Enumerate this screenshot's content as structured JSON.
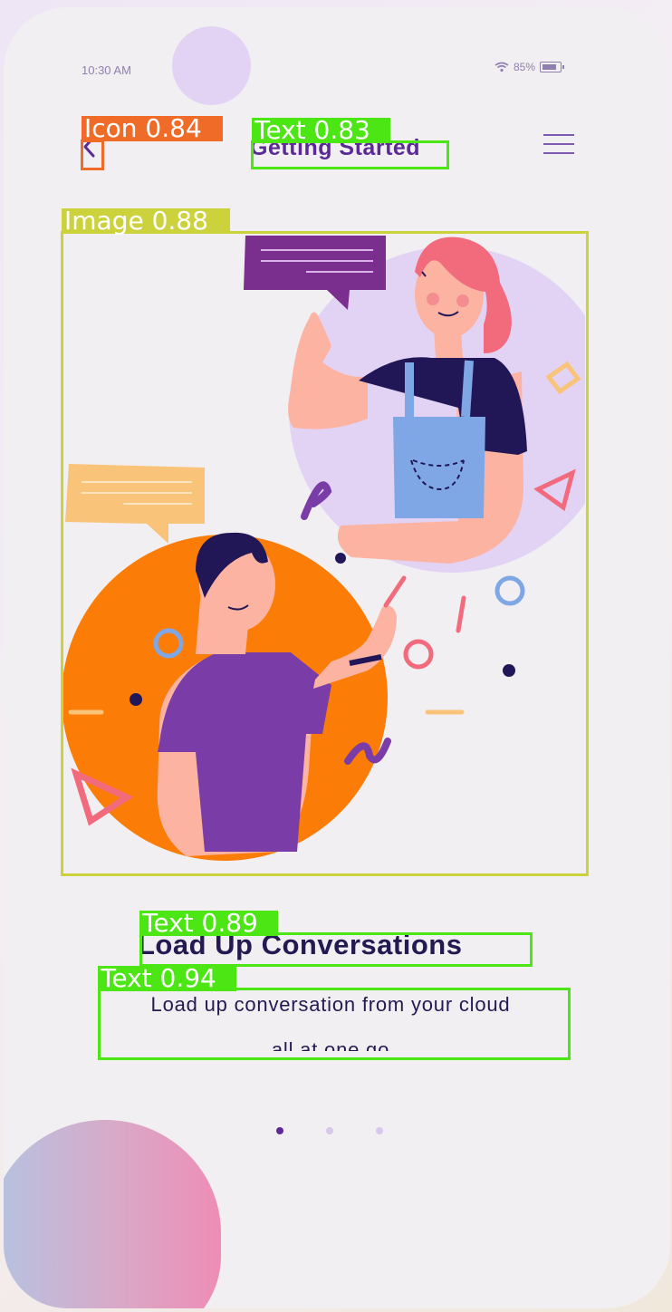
{
  "status_bar": {
    "time": "10:30 AM",
    "battery": "85%"
  },
  "header": {
    "title": "Getting Started"
  },
  "onboarding": {
    "headline": "Load Up Conversations",
    "subtitle_line1": "Load up conversation from your cloud",
    "subtitle_line2": "all at one go",
    "total_pages": 3,
    "active_page": 1
  },
  "detections": [
    {
      "label": "Icon 0.84",
      "color": "#f06b27"
    },
    {
      "label": "Text 0.83",
      "color": "#4ce614"
    },
    {
      "label": "Image 0.88",
      "color": "#ccd23b"
    },
    {
      "label": "Text 0.89",
      "color": "#4ce614"
    },
    {
      "label": "Text 0.94",
      "color": "#4ce614"
    }
  ],
  "colors": {
    "primary_purple": "#5b2a96",
    "dark_navy": "#231a52",
    "accent_orange": "#fb7d07",
    "lavender": "#e2d3f5"
  }
}
